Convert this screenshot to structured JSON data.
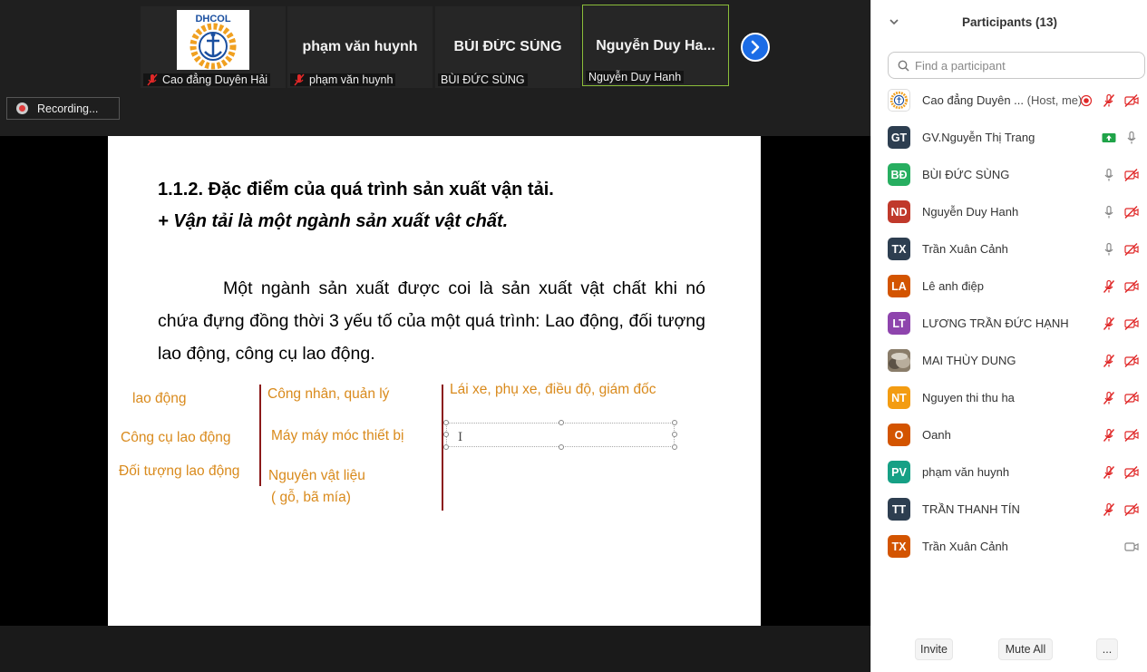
{
  "thumbnails": [
    {
      "name": "",
      "label": "Cao đẳng Duyên Hải",
      "muted": true,
      "has_logo": true,
      "logo_text": "DHCOL"
    },
    {
      "name": "phạm văn huynh",
      "label": "phạm văn huynh",
      "muted": true
    },
    {
      "name": "BÙI ĐỨC SÙNG",
      "label": "BÙI ĐỨC SÙNG",
      "muted": false
    },
    {
      "name": "Nguyễn Duy Ha...",
      "label": "Nguyễn Duy Hanh",
      "muted": false,
      "active": true
    }
  ],
  "recording": {
    "label": "Recording..."
  },
  "slide": {
    "title": "1.1.2. Đặc điểm của quá  trình sản xuất vận tải.",
    "subtitle": "+  Vận tải là một ngành sản xuất vật chất.",
    "paragraph": "Một ngành sản xuất được coi là sản xuất vật chất khi nó chứa đựng đồng thời 3 yếu tố của một quá trình: Lao động, đối tượng lao động, công cụ lao động.",
    "annotations": {
      "col1_a": "lao động",
      "col1_b": "Công cụ lao động",
      "col1_c": "Đối tượng lao động",
      "col2_a": "Công nhân, quản lý",
      "col2_b": "Máy máy móc thiết bị",
      "col2_c1": "Nguyên vật liệu",
      "col2_c2": "( gỗ, bã mía)",
      "col3_a": "Lái xe, phụ xe, điều độ, giám đốc"
    },
    "cursor_glyph": "I"
  },
  "panel": {
    "title": "Participants (13)",
    "search_placeholder": "Find a participant",
    "participants": [
      {
        "initials": "",
        "name": "Cao đẳng Duyên ...",
        "tag": "(Host, me)",
        "color": "#ffffff",
        "avatar_type": "logo",
        "icons": [
          "recording-icon",
          "mic-off-icon",
          "video-off-icon"
        ]
      },
      {
        "initials": "GT",
        "name": "GV.Nguyễn Thị Trang",
        "tag": "",
        "color": "#2d3e50",
        "icons": [
          "share-screen-icon",
          "mic-icon"
        ]
      },
      {
        "initials": "BĐ",
        "name": "BÙI ĐỨC SÙNG",
        "tag": "",
        "color": "#27ae60",
        "icons": [
          "mic-icon",
          "video-off-icon"
        ]
      },
      {
        "initials": "ND",
        "name": "Nguyễn Duy Hanh",
        "tag": "",
        "color": "#c0392b",
        "icons": [
          "mic-icon",
          "video-off-icon"
        ]
      },
      {
        "initials": "TX",
        "name": "Trần Xuân Cảnh",
        "tag": "",
        "color": "#2d3e50",
        "icons": [
          "mic-icon",
          "video-off-icon"
        ]
      },
      {
        "initials": "LA",
        "name": "Lê anh điệp",
        "tag": "",
        "color": "#d35400",
        "icons": [
          "mic-off-icon",
          "video-off-icon"
        ]
      },
      {
        "initials": "LT",
        "name": "LƯƠNG TRẦN ĐỨC HẠNH",
        "tag": "",
        "color": "#8e44ad",
        "icons": [
          "mic-off-icon",
          "video-off-icon"
        ]
      },
      {
        "initials": "",
        "name": "MAI THÙY DUNG",
        "tag": "",
        "color": "#7a6a55",
        "avatar_type": "photo",
        "icons": [
          "mic-off-icon",
          "video-off-icon"
        ]
      },
      {
        "initials": "NT",
        "name": "Nguyen thi thu ha",
        "tag": "",
        "color": "#f39c12",
        "icons": [
          "mic-off-icon",
          "video-off-icon"
        ]
      },
      {
        "initials": "O",
        "name": "Oanh",
        "tag": "",
        "color": "#d35400",
        "icons": [
          "mic-off-icon",
          "video-off-icon"
        ]
      },
      {
        "initials": "PV",
        "name": "phạm văn huynh",
        "tag": "",
        "color": "#16a085",
        "icons": [
          "mic-off-icon",
          "video-off-icon"
        ]
      },
      {
        "initials": "TT",
        "name": "TRẦN THANH TÍN",
        "tag": "",
        "color": "#2d3e50",
        "icons": [
          "mic-off-icon",
          "video-off-icon"
        ]
      },
      {
        "initials": "TX",
        "name": "Trần Xuân Cảnh",
        "tag": "",
        "color": "#d35400",
        "icons": [
          "video-icon"
        ]
      }
    ],
    "footer": {
      "invite": "Invite",
      "mute_all": "Mute All",
      "more": "..."
    }
  }
}
